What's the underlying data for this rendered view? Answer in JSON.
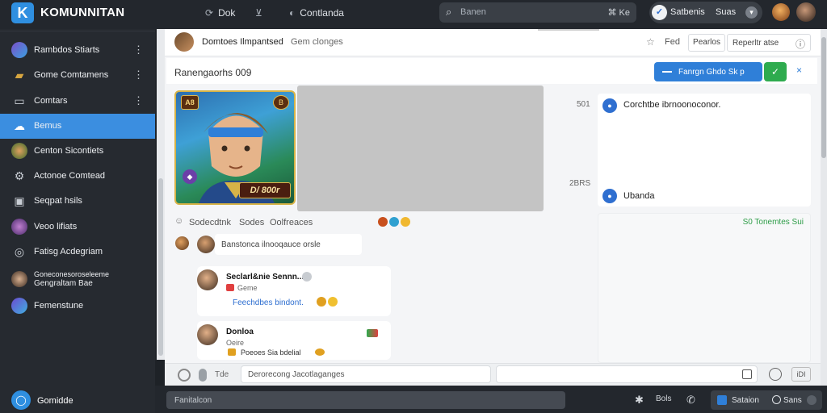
{
  "app": {
    "title": "KOMUNNITAN",
    "logo": "K"
  },
  "topnav": {
    "items": [
      {
        "label": "Dok",
        "icon": "refresh-icon"
      },
      {
        "label": "Contlanda",
        "icon": "chat-icon"
      }
    ],
    "search_placeholder": "Banen",
    "search_shortcut": "⌘ Ke",
    "user": {
      "name": "Satbenis",
      "status": "Suas",
      "icon": "check-icon"
    }
  },
  "sidebar": {
    "items": [
      {
        "label": "Rambdos Stiarts",
        "icon": "avatar-icon",
        "more": true
      },
      {
        "label": "Gome Comtamens",
        "icon": "folder-icon",
        "more": true
      },
      {
        "label": "Comtars",
        "icon": "inbox-icon",
        "more": true
      },
      {
        "label": "Bemus",
        "icon": "cloud-icon",
        "active": true
      },
      {
        "label": "Centon Sicontiets",
        "icon": "avatar-icon"
      },
      {
        "label": "Actonoe Comtead",
        "icon": "gear-icon"
      },
      {
        "label": "Seqpat hsils",
        "icon": "layout-icon"
      },
      {
        "label": "Veoo lifiats",
        "icon": "avatar-icon"
      },
      {
        "label": "Fatisg Acdegriam",
        "icon": "globe-icon"
      },
      {
        "label": "Goneconesoroseleeme",
        "label2": "Gengraltam Bae",
        "icon": "avatar-icon"
      },
      {
        "label": "Femenstune",
        "icon": "planet-icon"
      }
    ],
    "footer": "Gomidde"
  },
  "channel": {
    "name": "Domtoes Ilmpantsed",
    "subtitle": "Gem clonges",
    "find": "Fed",
    "btn1": "Pearlos",
    "btn2": "Reperltr atse"
  },
  "panel": {
    "title": "Ranengaorhs 009",
    "primary_action": "Fanrgn Ghdo Sk p",
    "ok": "✓",
    "close": "×"
  },
  "game_card": {
    "badge_left": "A8",
    "badge_right": "B",
    "tag": "D/ 800r"
  },
  "right_panel": {
    "time1": "501",
    "time2": "2BRS",
    "item1": "Corchtbe ibrnoonoconor.",
    "item2": "Ubanda",
    "green": "S0  Tonemtes  Sui"
  },
  "reactions": {
    "a": "Sodecdtnk",
    "b": "Sodes",
    "c": "Oolfreaces"
  },
  "thread": {
    "reply_placeholder": "Banstonca ilnooqauce orsle"
  },
  "messages": [
    {
      "name": "Seclarl&nie Sennn...",
      "sub": "Geme",
      "text": "Feechdbes bindont."
    },
    {
      "name": "Donloa",
      "sub": "Oeire",
      "text": "Poeoes Sia bdelial"
    }
  ],
  "composer": {
    "label": "Tde",
    "placeholder": "Derorecong Jacotlaganges",
    "box": "iDI"
  },
  "bottombar": {
    "input": "Fanitalcon",
    "label1": "Bols",
    "chip_label1": "Sataion",
    "chip_label2": "Sans"
  },
  "colors": {
    "accent": "#2f7fd8",
    "active_item": "#3b8ee0",
    "success": "#2eab4e",
    "sidebar_bg": "#262a30"
  }
}
